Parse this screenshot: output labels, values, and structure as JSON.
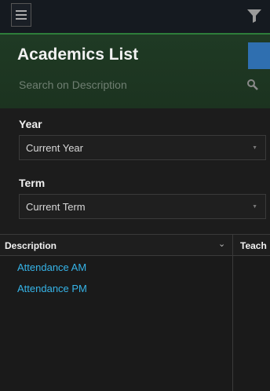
{
  "header": {
    "title": "Academics List",
    "search_placeholder": "Search on Description"
  },
  "filters": {
    "year": {
      "label": "Year",
      "value": "Current Year"
    },
    "term": {
      "label": "Term",
      "value": "Current Term"
    }
  },
  "grid": {
    "columns": [
      {
        "label": "Description"
      },
      {
        "label": "Teach"
      }
    ],
    "rows": [
      {
        "description": "Attendance AM"
      },
      {
        "description": "Attendance PM"
      }
    ]
  },
  "colors": {
    "accent_green": "#2e7d3a",
    "header_panel": "#1f3a24",
    "link_blue": "#36b4e8",
    "button_blue": "#2f6fb0"
  },
  "icons": [
    "hamburger-menu-icon",
    "filter-icon",
    "search-icon",
    "chevron-down-icon"
  ]
}
